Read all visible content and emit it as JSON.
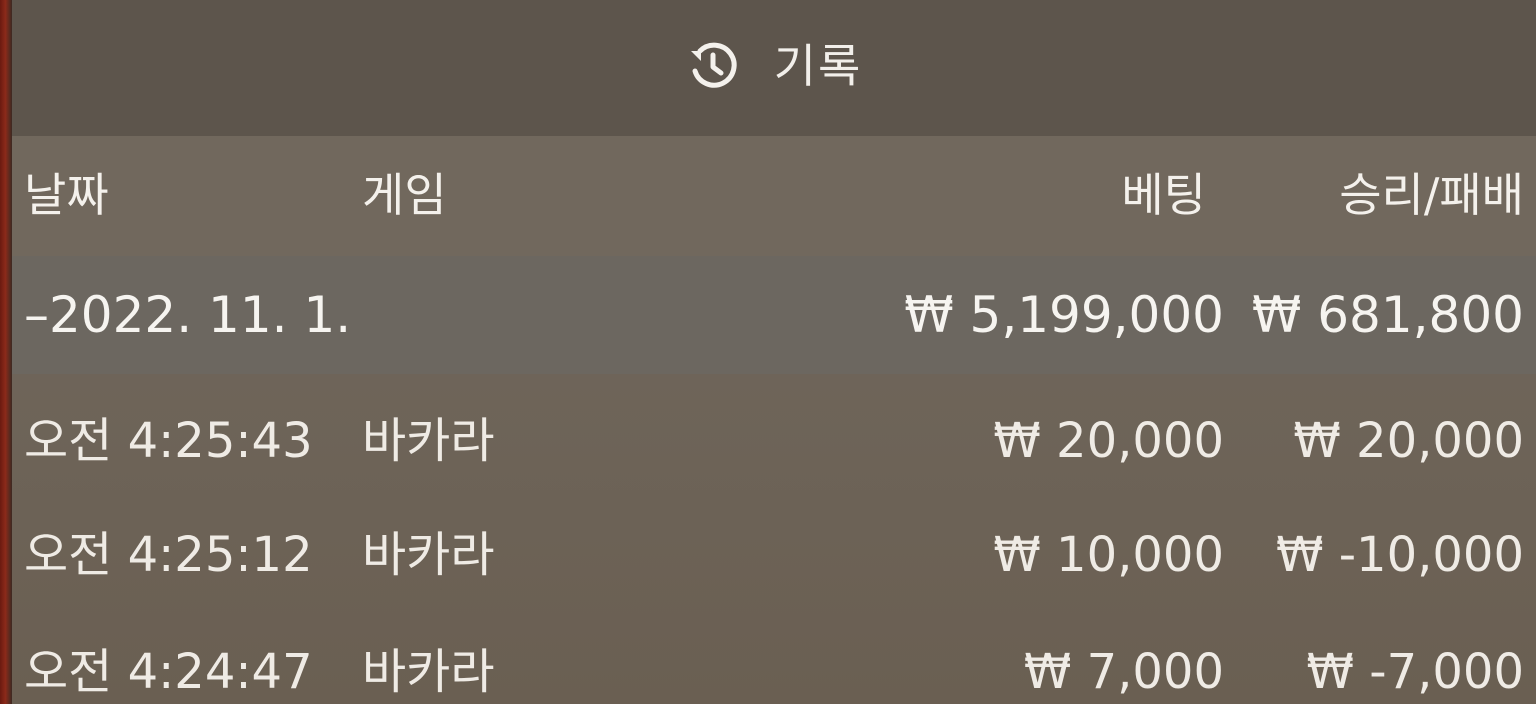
{
  "header": {
    "icon": "history-icon",
    "title": "기록"
  },
  "columns": {
    "date": "날짜",
    "game": "게임",
    "bet": "베팅",
    "winloss": "승리/패배"
  },
  "day_group": {
    "label": "–2022. 11. 1.",
    "bet_total": "₩ 5,199,000",
    "winloss_total": "₩ 681,800"
  },
  "rows": [
    {
      "time": "오전 4:25:43",
      "game": "바카라",
      "bet": "₩ 20,000",
      "winloss": "₩ 20,000"
    },
    {
      "time": "오전 4:25:12",
      "game": "바카라",
      "bet": "₩ 10,000",
      "winloss": "₩ -10,000"
    },
    {
      "time": "오전 4:24:47",
      "game": "바카라",
      "bet": "₩ 7,000",
      "winloss": "₩ -7,000"
    }
  ]
}
